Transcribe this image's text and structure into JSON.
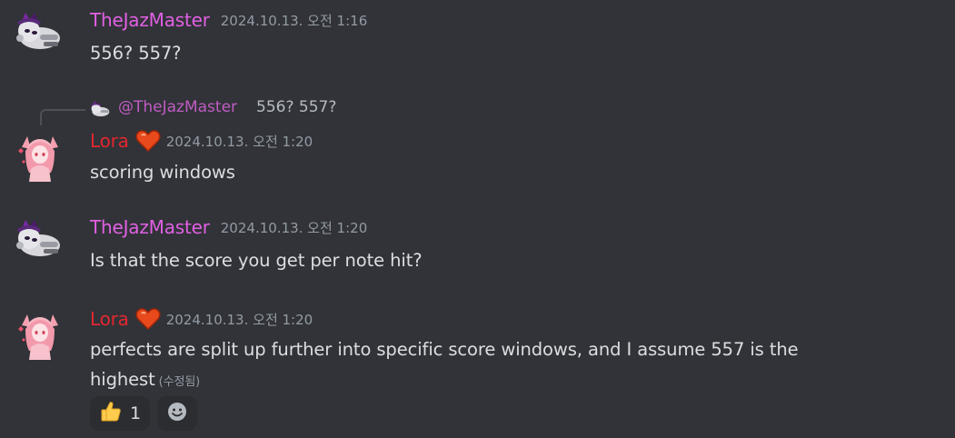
{
  "colors": {
    "background": "#313338",
    "jaz_name": "#e160e3",
    "lora_name": "#e3272f",
    "timestamp": "#949ba4",
    "text": "#dbdee1"
  },
  "messages": [
    {
      "author": "TheJazMaster",
      "timestamp": "2024.10.13. 오전 1:16",
      "content": "556? 557?"
    },
    {
      "reply": {
        "author": "@TheJazMaster",
        "content": "556? 557?"
      },
      "author": "Lora",
      "badge_icon": "heart-icon",
      "timestamp": "2024.10.13. 오전 1:20",
      "content": "scoring windows"
    },
    {
      "author": "TheJazMaster",
      "timestamp": "2024.10.13. 오전 1:20",
      "content": "Is that the score you get per note hit?"
    },
    {
      "author": "Lora",
      "badge_icon": "heart-icon",
      "timestamp": "2024.10.13. 오전 1:20",
      "content": "perfects are split up further into specific score windows, and I assume 557 is the highest",
      "edited": "(수정됨)",
      "reactions": [
        {
          "emoji": "thumbs-up-icon",
          "count": "1"
        },
        {
          "emoji": "add-reaction-icon"
        }
      ]
    }
  ]
}
